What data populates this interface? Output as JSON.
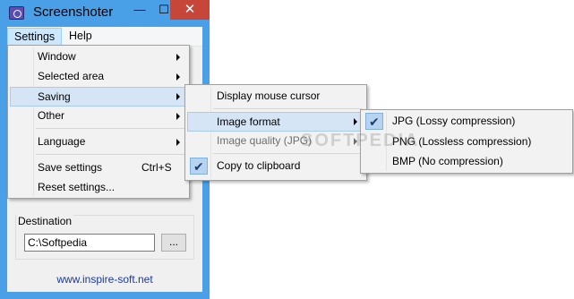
{
  "window": {
    "title": "Screenshoter",
    "controls": {
      "minimize": "—",
      "maximize": "☐",
      "close": "✕"
    }
  },
  "menubar": {
    "settings": "Settings",
    "help": "Help"
  },
  "destination": {
    "label": "Destination",
    "value": "C:\\Softpedia",
    "browse_label": "..."
  },
  "footer": {
    "link": "www.inspire-soft.net"
  },
  "settings_menu": {
    "items": [
      {
        "label": "Window"
      },
      {
        "label": "Selected area"
      },
      {
        "label": "Saving"
      },
      {
        "label": "Other"
      },
      {
        "label": "Language"
      },
      {
        "label": "Save settings",
        "shortcut": "Ctrl+S"
      },
      {
        "label": "Reset settings..."
      }
    ]
  },
  "saving_menu": {
    "items": [
      {
        "label": "Display mouse cursor"
      },
      {
        "label": "Image format"
      },
      {
        "label": "Image quality (JPG)"
      },
      {
        "label": "Copy to clipboard",
        "checked": true
      }
    ]
  },
  "format_menu": {
    "items": [
      {
        "label": "JPG (Lossy compression)",
        "checked": true
      },
      {
        "label": "PNG (Lossless compression)"
      },
      {
        "label": "BMP (No compression)"
      }
    ]
  },
  "watermark": "SOFTPEDIA",
  "icons": {
    "app": "camera-icon",
    "check": "checkmark-icon",
    "submenu": "chevron-right-icon"
  },
  "colors": {
    "titlebar": "#4aa0e6",
    "close_button": "#c7463a",
    "menu_highlight": "#d5e5f5",
    "link": "#1a3a9e"
  }
}
